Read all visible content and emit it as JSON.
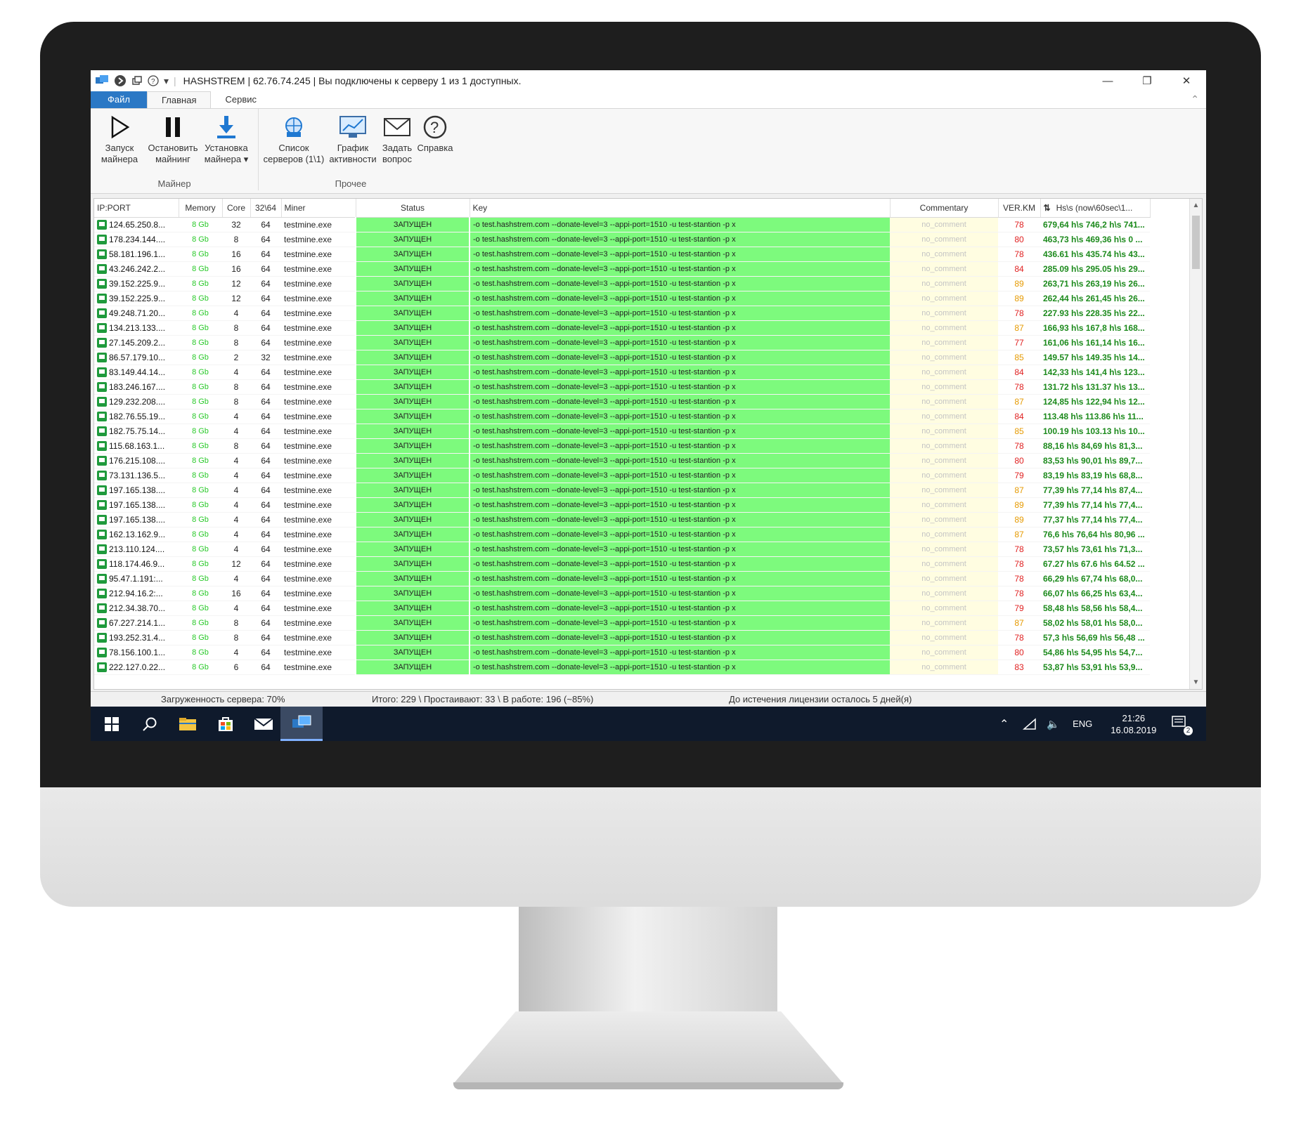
{
  "window": {
    "title": "HASHSTREM | 62.76.74.245 | Вы подключены к серверу 1 из 1 доступных.",
    "minimize": "—",
    "restore": "❐",
    "close": "✕"
  },
  "tabs": [
    {
      "label": "Файл"
    },
    {
      "label": "Главная"
    },
    {
      "label": "Сервис"
    }
  ],
  "ribbon": {
    "miner_group": {
      "label": "Майнер",
      "buttons": [
        {
          "line1": "Запуск",
          "line2": "майнера"
        },
        {
          "line1": "Остановить",
          "line2": "майнинг"
        },
        {
          "line1": "Установка",
          "line2": "майнера ▾"
        }
      ]
    },
    "other_group": {
      "label": "Прочее",
      "buttons": [
        {
          "line1": "Список",
          "line2": "серверов (1\\1)"
        },
        {
          "line1": "График",
          "line2": "активности"
        },
        {
          "line1": "Задать",
          "line2": "вопрос"
        },
        {
          "line1": "Справка",
          "line2": ""
        }
      ]
    }
  },
  "grid": {
    "columns": [
      "IP:PORT",
      "Memory",
      "Core",
      "32\\64",
      "Miner",
      "Status",
      "Key",
      "Commentary",
      "VER.KM",
      "Hs\\s (now\\60sec\\1..."
    ],
    "status_text": "ЗАПУЩЕН",
    "key_text": "-o test.hashstrem.com --donate-level=3 --appi-port=1510 -u test-stantion -p x",
    "comment_text": "no_comment",
    "rows": [
      {
        "ip": "124.65.250.8...",
        "mem": "8 Gb",
        "core": "32",
        "bits": "64",
        "miner": "testmine.exe",
        "ver": "78",
        "hs": "679,64 h\\s 746,2 h\\s 741..."
      },
      {
        "ip": "178.234.144....",
        "mem": "8 Gb",
        "core": "8",
        "bits": "64",
        "miner": "testmine.exe",
        "ver": "80",
        "hs": "463,73 h\\s 469,36 h\\s 0 ..."
      },
      {
        "ip": "58.181.196.1...",
        "mem": "8 Gb",
        "core": "16",
        "bits": "64",
        "miner": "testmine.exe",
        "ver": "78",
        "hs": "436.61 h\\s 435.74 h\\s 43..."
      },
      {
        "ip": "43.246.242.2...",
        "mem": "8 Gb",
        "core": "16",
        "bits": "64",
        "miner": "testmine.exe",
        "ver": "84",
        "hs": "285.09 h\\s 295.05 h\\s 29..."
      },
      {
        "ip": "39.152.225.9...",
        "mem": "8 Gb",
        "core": "12",
        "bits": "64",
        "miner": "testmine.exe",
        "ver": "89",
        "hs": "263,71 h\\s 263,19 h\\s 26..."
      },
      {
        "ip": "39.152.225.9...",
        "mem": "8 Gb",
        "core": "12",
        "bits": "64",
        "miner": "testmine.exe",
        "ver": "89",
        "hs": "262,44 h\\s 261,45 h\\s 26..."
      },
      {
        "ip": "49.248.71.20...",
        "mem": "8 Gb",
        "core": "4",
        "bits": "64",
        "miner": "testmine.exe",
        "ver": "78",
        "hs": "227.93 h\\s 228.35 h\\s 22..."
      },
      {
        "ip": "134.213.133....",
        "mem": "8 Gb",
        "core": "8",
        "bits": "64",
        "miner": "testmine.exe",
        "ver": "87",
        "hs": "166,93 h\\s 167,8 h\\s 168..."
      },
      {
        "ip": "27.145.209.2...",
        "mem": "8 Gb",
        "core": "8",
        "bits": "64",
        "miner": "testmine.exe",
        "ver": "77",
        "hs": "161,06 h\\s 161,14 h\\s 16..."
      },
      {
        "ip": "86.57.179.10...",
        "mem": "8 Gb",
        "core": "2",
        "bits": "32",
        "miner": "testmine.exe",
        "ver": "85",
        "hs": "149.57 h\\s 149.35 h\\s 14..."
      },
      {
        "ip": "83.149.44.14...",
        "mem": "8 Gb",
        "core": "4",
        "bits": "64",
        "miner": "testmine.exe",
        "ver": "84",
        "hs": "142,33 h\\s 141,4 h\\s 123..."
      },
      {
        "ip": "183.246.167....",
        "mem": "8 Gb",
        "core": "8",
        "bits": "64",
        "miner": "testmine.exe",
        "ver": "78",
        "hs": "131.72 h\\s 131.37 h\\s 13..."
      },
      {
        "ip": "129.232.208....",
        "mem": "8 Gb",
        "core": "8",
        "bits": "64",
        "miner": "testmine.exe",
        "ver": "87",
        "hs": "124,85 h\\s 122,94 h\\s 12..."
      },
      {
        "ip": "182.76.55.19...",
        "mem": "8 Gb",
        "core": "4",
        "bits": "64",
        "miner": "testmine.exe",
        "ver": "84",
        "hs": "113.48 h\\s 113.86 h\\s 11..."
      },
      {
        "ip": "182.75.75.14...",
        "mem": "8 Gb",
        "core": "4",
        "bits": "64",
        "miner": "testmine.exe",
        "ver": "85",
        "hs": "100.19 h\\s 103.13 h\\s 10..."
      },
      {
        "ip": "115.68.163.1...",
        "mem": "8 Gb",
        "core": "8",
        "bits": "64",
        "miner": "testmine.exe",
        "ver": "78",
        "hs": "88,16 h\\s 84,69 h\\s 81,3..."
      },
      {
        "ip": "176.215.108....",
        "mem": "8 Gb",
        "core": "4",
        "bits": "64",
        "miner": "testmine.exe",
        "ver": "80",
        "hs": "83,53 h\\s 90,01 h\\s 89,7..."
      },
      {
        "ip": "73.131.136.5...",
        "mem": "8 Gb",
        "core": "4",
        "bits": "64",
        "miner": "testmine.exe",
        "ver": "79",
        "hs": "83,19 h\\s 83,19 h\\s 68,8..."
      },
      {
        "ip": "197.165.138....",
        "mem": "8 Gb",
        "core": "4",
        "bits": "64",
        "miner": "testmine.exe",
        "ver": "87",
        "hs": "77,39 h\\s 77,14 h\\s 87,4..."
      },
      {
        "ip": "197.165.138....",
        "mem": "8 Gb",
        "core": "4",
        "bits": "64",
        "miner": "testmine.exe",
        "ver": "89",
        "hs": "77,39 h\\s 77,14 h\\s 77,4..."
      },
      {
        "ip": "197.165.138....",
        "mem": "8 Gb",
        "core": "4",
        "bits": "64",
        "miner": "testmine.exe",
        "ver": "89",
        "hs": "77,37 h\\s 77,14 h\\s 77,4..."
      },
      {
        "ip": "162.13.162.9...",
        "mem": "8 Gb",
        "core": "4",
        "bits": "64",
        "miner": "testmine.exe",
        "ver": "87",
        "hs": "76,6 h\\s 76,64 h\\s 80,96 ..."
      },
      {
        "ip": "213.110.124....",
        "mem": "8 Gb",
        "core": "4",
        "bits": "64",
        "miner": "testmine.exe",
        "ver": "78",
        "hs": "73,57 h\\s 73,61 h\\s 71,3..."
      },
      {
        "ip": "118.174.46.9...",
        "mem": "8 Gb",
        "core": "12",
        "bits": "64",
        "miner": "testmine.exe",
        "ver": "78",
        "hs": "67.27 h\\s 67.6 h\\s 64.52 ..."
      },
      {
        "ip": "95.47.1.191:...",
        "mem": "8 Gb",
        "core": "4",
        "bits": "64",
        "miner": "testmine.exe",
        "ver": "78",
        "hs": "66,29 h\\s 67,74 h\\s 68,0..."
      },
      {
        "ip": "212.94.16.2:...",
        "mem": "8 Gb",
        "core": "16",
        "bits": "64",
        "miner": "testmine.exe",
        "ver": "78",
        "hs": "66,07 h\\s 66,25 h\\s 63,4..."
      },
      {
        "ip": "212.34.38.70...",
        "mem": "8 Gb",
        "core": "4",
        "bits": "64",
        "miner": "testmine.exe",
        "ver": "79",
        "hs": "58,48 h\\s 58,56 h\\s 58,4..."
      },
      {
        "ip": "67.227.214.1...",
        "mem": "8 Gb",
        "core": "8",
        "bits": "64",
        "miner": "testmine.exe",
        "ver": "87",
        "hs": "58,02 h\\s 58,01 h\\s 58,0..."
      },
      {
        "ip": "193.252.31.4...",
        "mem": "8 Gb",
        "core": "8",
        "bits": "64",
        "miner": "testmine.exe",
        "ver": "78",
        "hs": "57,3 h\\s 56,69 h\\s 56,48 ..."
      },
      {
        "ip": "78.156.100.1...",
        "mem": "8 Gb",
        "core": "4",
        "bits": "64",
        "miner": "testmine.exe",
        "ver": "80",
        "hs": "54,86 h\\s 54,95 h\\s 54,7..."
      },
      {
        "ip": "222.127.0.22...",
        "mem": "8 Gb",
        "core": "6",
        "bits": "64",
        "miner": "testmine.exe",
        "ver": "83",
        "hs": "53,87 h\\s 53,91 h\\s 53,9..."
      }
    ]
  },
  "statusbar": {
    "load": "Загруженность сервера: 70%",
    "totals": "Итого: 229 \\ Простаивают: 33 \\ В работе: 196 (~85%)",
    "license": "До истечения лицензии осталось 5 дней(я)"
  },
  "taskbar": {
    "lang": "ENG",
    "time": "21:26",
    "date": "16.08.2019",
    "notifications": "2"
  },
  "colors": {
    "accent": "#2b78c5",
    "running": "#7dfa7d",
    "comment_bg": "#fffde1",
    "hashrate": "#1c8a1c",
    "ver_red": "#e02020",
    "ver_orange": "#e69a00",
    "taskbar": "#0f1a2c"
  }
}
